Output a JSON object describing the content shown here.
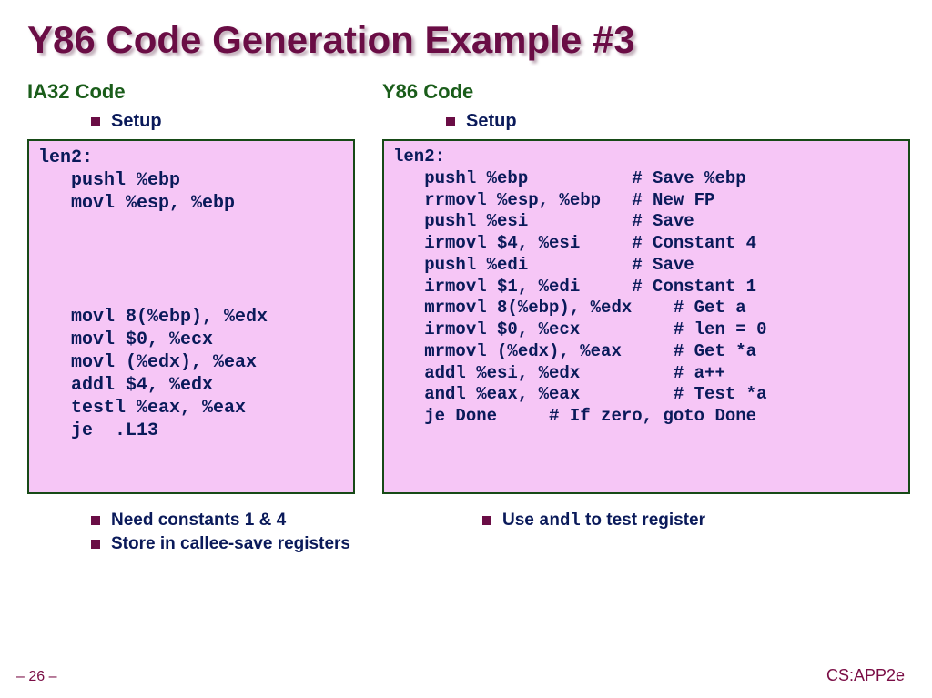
{
  "title": "Y86 Code Generation Example #3",
  "left": {
    "heading": "IA32 Code",
    "bullet": "Setup",
    "code": "len2:\n   pushl %ebp\n   movl %esp, %ebp\n\n\n\n\n   movl 8(%ebp), %edx\n   movl $0, %ecx\n   movl (%edx), %eax\n   addl $4, %edx\n   testl %eax, %eax\n   je  .L13"
  },
  "right": {
    "heading": "Y86 Code",
    "bullet": "Setup",
    "code": "len2:\n   pushl %ebp          # Save %ebp\n   rrmovl %esp, %ebp   # New FP\n   pushl %esi          # Save\n   irmovl $4, %esi     # Constant 4\n   pushl %edi          # Save\n   irmovl $1, %edi     # Constant 1\n   mrmovl 8(%ebp), %edx    # Get a\n   irmovl $0, %ecx         # len = 0\n   mrmovl (%edx), %eax     # Get *a\n   addl %esi, %edx         # a++\n   andl %eax, %eax         # Test *a\n   je Done     # If zero, goto Done"
  },
  "footer_left": {
    "b1": "Need constants 1 & 4",
    "b2": "Store in callee-save registers"
  },
  "footer_right": {
    "b1_pre": "Use ",
    "b1_mono": "andl",
    "b1_post": " to test register"
  },
  "page": "– 26 –",
  "course": "CS:APP2e"
}
